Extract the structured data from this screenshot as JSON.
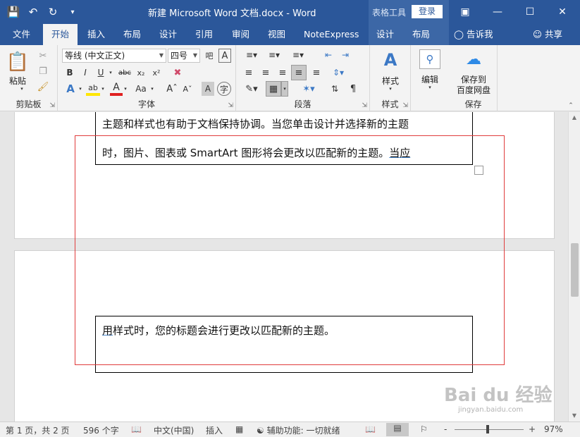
{
  "window": {
    "title": "新建 Microsoft Word 文档.docx  -  Word",
    "context_label": "表格工具",
    "login": "登录",
    "controls": [
      "restore-ribbon",
      "minimize",
      "maximize",
      "close"
    ]
  },
  "qat": {
    "save": "save-icon",
    "undo": "undo-icon",
    "redo": "redo-icon",
    "customize": "customize-icon"
  },
  "tabs": [
    "文件",
    "开始",
    "插入",
    "布局",
    "设计",
    "引用",
    "审阅",
    "视图",
    "NoteExpress",
    "设计",
    "布局"
  ],
  "active_tab": "开始",
  "tell_me": "告诉我",
  "share": "共享",
  "ribbon": {
    "clipboard": {
      "paste": "粘贴",
      "label": "剪贴板"
    },
    "font": {
      "name": "等线 (中文正文)",
      "size": "四号",
      "label": "字体"
    },
    "paragraph": {
      "label": "段落"
    },
    "styles": {
      "button": "样式",
      "label": "样式"
    },
    "editing": {
      "button": "编辑"
    },
    "save": {
      "button_line1": "保存到",
      "button_line2": "百度网盘",
      "label": "保存"
    }
  },
  "document": {
    "box1_line1": "主题和样式也有助于文档保持协调。当您单击设计并选择新的主题",
    "box1_line2_a": "时，图片、图表或 SmartArt 图形将会更改以匹配新的主题。",
    "box1_line2_b": "当应",
    "box2_line1_a": "用",
    "box2_line1_b": "样式时，您的标题会进行更改以匹配新的主题。"
  },
  "status": {
    "page": "第 1 页，共 2 页",
    "words": "596 个字",
    "language": "中文(中国)",
    "mode": "插入",
    "accessibility": "辅助功能: 一切就绪",
    "zoom": "97%",
    "zoom_minus": "-",
    "zoom_plus": "+"
  },
  "watermark": {
    "brand": "Bai du 经验",
    "url": "jingyan.baidu.com"
  },
  "colors": {
    "accent": "#2b579a",
    "context": "#3c67a6",
    "selection": "#e03c3c"
  }
}
